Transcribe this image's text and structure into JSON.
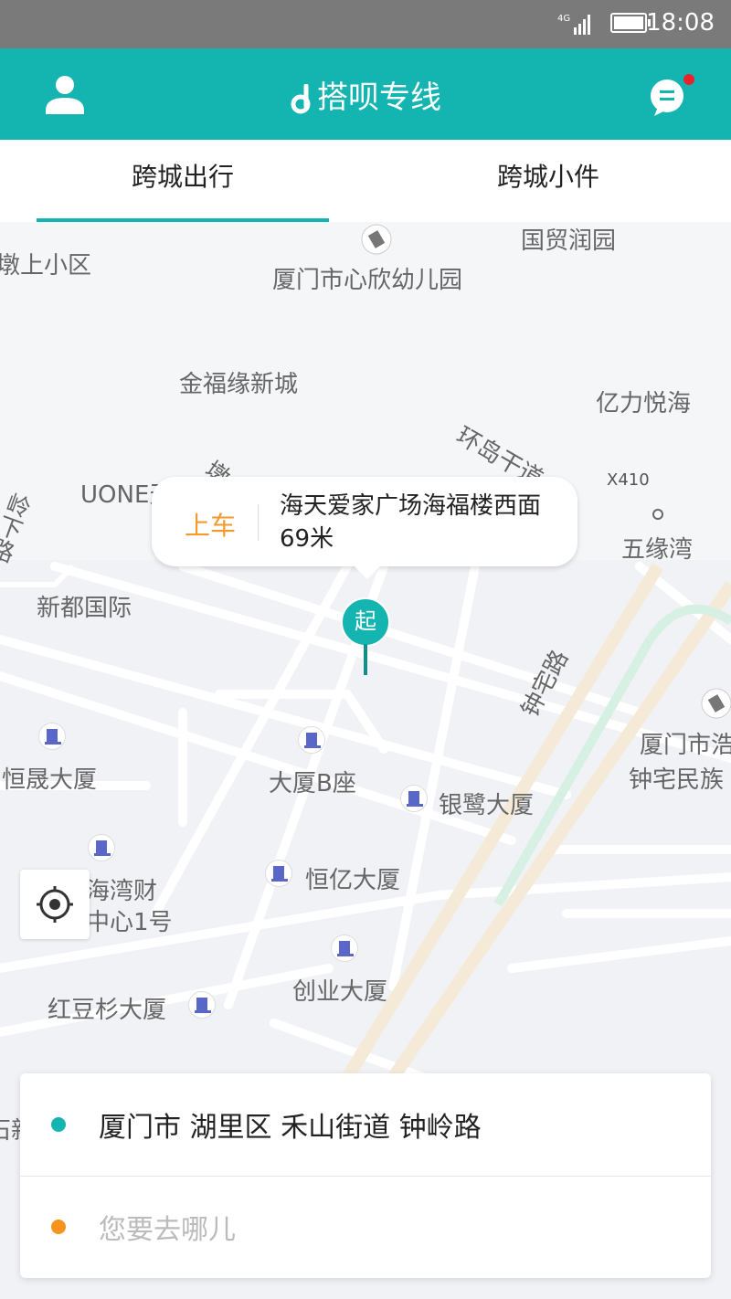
{
  "status_bar": {
    "time": "18:08",
    "network": "4G"
  },
  "header": {
    "title": "搭呗专线",
    "unread_dot_color": "#e8232b",
    "bg_color": "#14b4b1"
  },
  "tabs": [
    {
      "label": "跨城出行",
      "active": true
    },
    {
      "label": "跨城小件",
      "active": false
    }
  ],
  "map": {
    "labels": {
      "l1": "墩上小区",
      "l2": "国贸润园",
      "l3": "厦门市心欣幼儿园",
      "l4": "金福缘新城",
      "l5": "亿力悦海",
      "l6": "环岛干道",
      "l7": "X410",
      "l8": "UONE天",
      "l9": "墩",
      "l10": "五缘湾",
      "l11": "新都国际",
      "l12": "钟宅路",
      "l13": "厦门市浩",
      "l14": "钟宅民族",
      "l15": "恒晟大厦",
      "l16": "大厦B座",
      "l17": "银鹭大厦",
      "l18": "海湾财",
      "l19": "中心1号",
      "l20": "恒亿大厦",
      "l21": "创业大厦",
      "l22": "红豆杉大厦",
      "l23": "岭下路",
      "l24": "石新"
    },
    "pickup_bubble": {
      "tag": "上车",
      "address": "海天爱家广场海福楼西面69米"
    },
    "pin_label": "起"
  },
  "route_card": {
    "origin": "厦门市 湖里区 禾山街道 钟岭路",
    "destination_placeholder": "您要去哪儿",
    "origin_dot_color": "#14b4b1",
    "destination_dot_color": "#f7941d"
  }
}
